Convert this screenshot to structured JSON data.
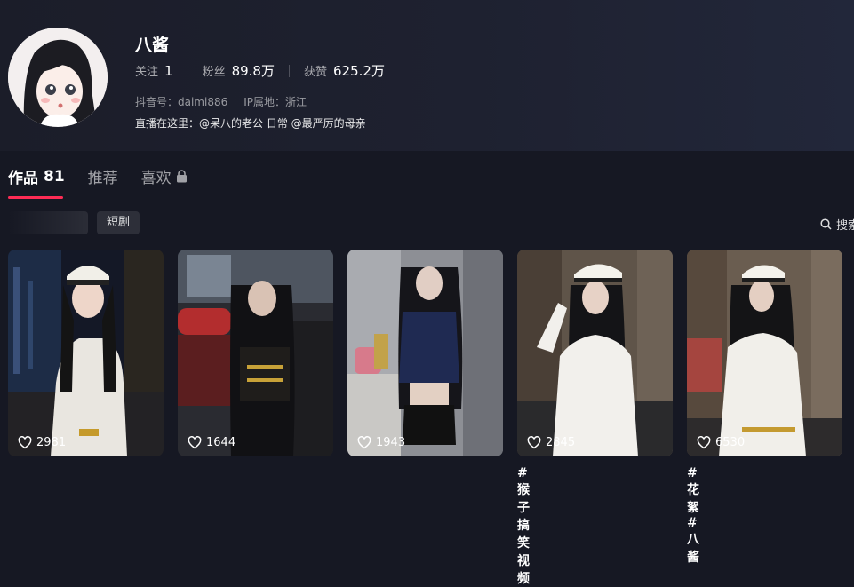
{
  "profile": {
    "name": "八酱",
    "stats": [
      {
        "label": "关注",
        "value": "1"
      },
      {
        "label": "粉丝",
        "value": "89.8万"
      },
      {
        "label": "获赞",
        "value": "625.2万"
      }
    ],
    "douyin_id": "抖音号：daimi886",
    "ip": "IP属地：浙江",
    "bio": "直播在这里：@呆八的老公 日常 @最严厉的母亲"
  },
  "tabs": [
    {
      "label": "作品",
      "count": "81",
      "active": true
    },
    {
      "label": "推荐",
      "count": "",
      "active": false
    },
    {
      "label": "喜欢",
      "count": "",
      "active": false,
      "icon": "lock-icon"
    }
  ],
  "filters": {
    "chips": [
      "短剧"
    ]
  },
  "search": {
    "label": "搜索",
    "icon": "search-icon"
  },
  "videos": [
    {
      "likes": "2981",
      "caption": ""
    },
    {
      "likes": "1644",
      "caption": ""
    },
    {
      "likes": "1943",
      "caption": ""
    },
    {
      "likes": "2845",
      "caption": "#猴子搞笑视频"
    },
    {
      "likes": "6530",
      "caption": "#花絮 #八酱"
    }
  ],
  "colors": {
    "accent": "#fe2c55",
    "background": "#161823"
  }
}
